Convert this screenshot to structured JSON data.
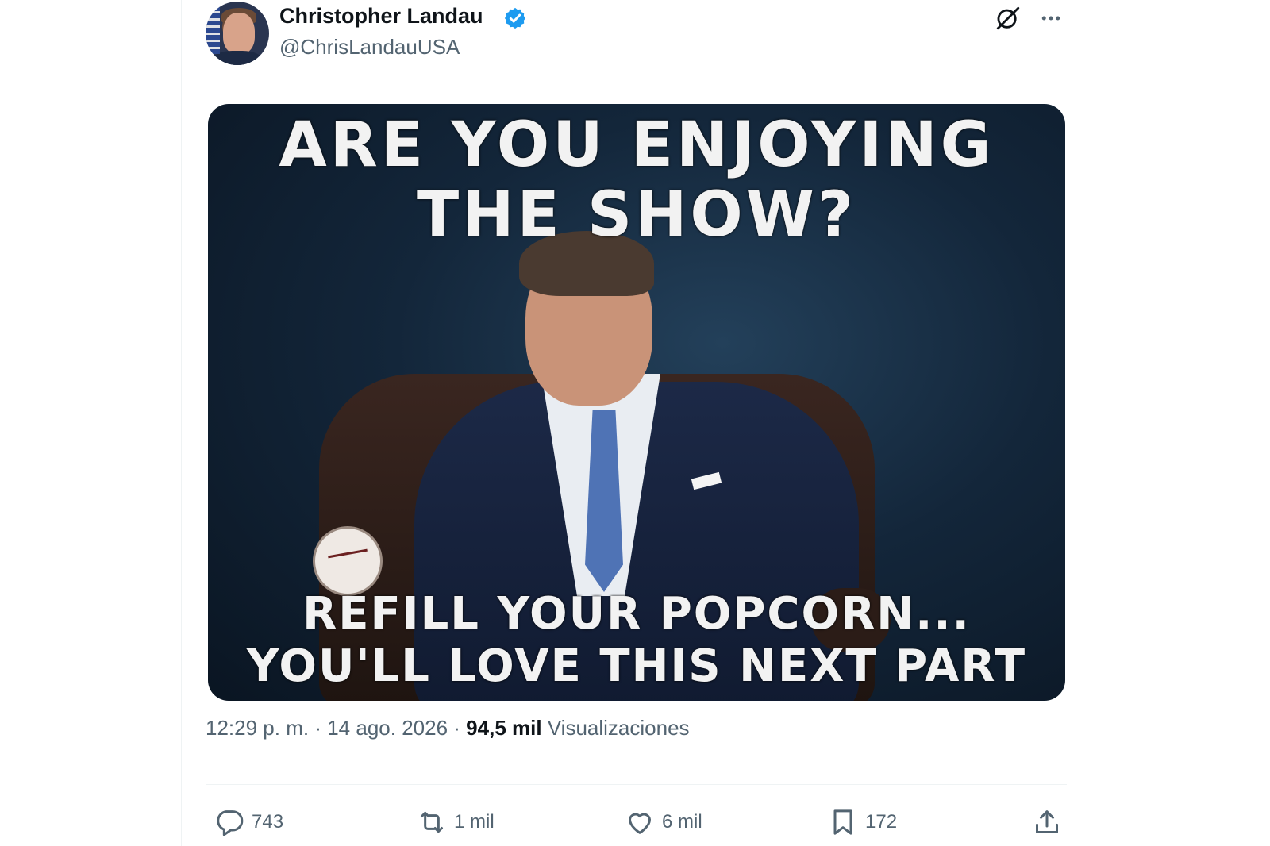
{
  "tweet": {
    "author_name": "Christopher Landau",
    "author_handle": "@ChrisLandauUSA",
    "verified": true,
    "media": {
      "top_caption_line1": "ARE YOU ENJOYING",
      "top_caption_line2": "THE SHOW?",
      "bottom_caption_line1": "REFILL YOUR POPCORN...",
      "bottom_caption_line2": "YOU'LL LOVE THIS NEXT PART"
    },
    "time": "12:29 p. m.",
    "separator": "·",
    "date": "14 ago. 2026",
    "views_count": "94,5 mil",
    "views_label": "Visualizaciones",
    "stats": {
      "replies": "743",
      "retweets": "1 mil",
      "likes": "6 mil",
      "bookmarks": "172"
    }
  },
  "icons": {
    "verified": "verified-badge-icon",
    "grok": "grok-icon",
    "more": "more-icon",
    "reply": "reply-icon",
    "retweet": "retweet-icon",
    "like": "heart-icon",
    "bookmark": "bookmark-icon",
    "share": "share-icon"
  },
  "colors": {
    "text_primary": "#0f1419",
    "text_secondary": "#536471",
    "verified_blue": "#1d9bf0"
  }
}
